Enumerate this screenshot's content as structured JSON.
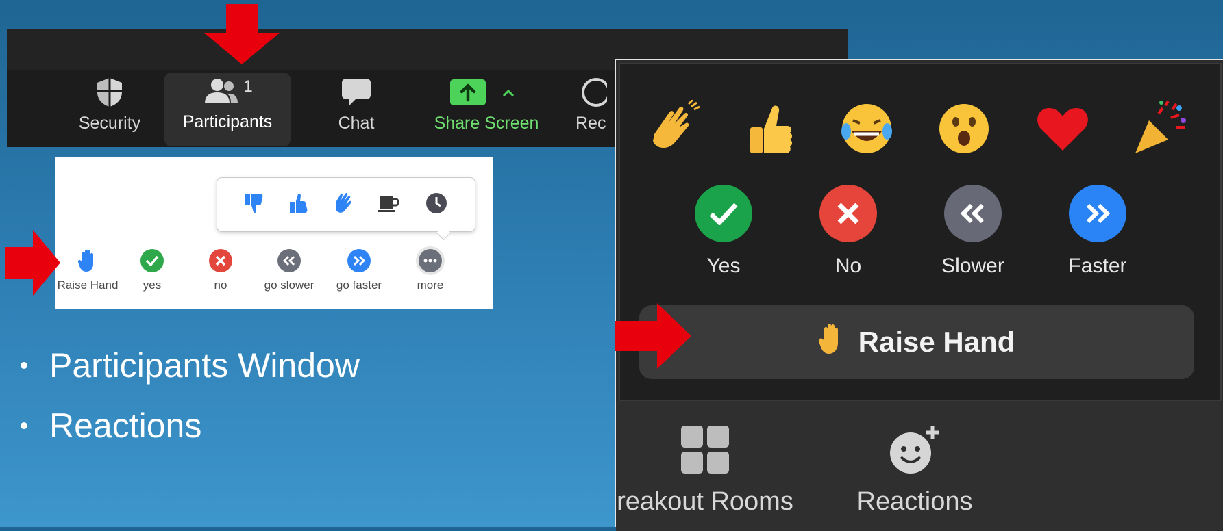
{
  "toolbar": {
    "items": [
      {
        "label": "Security",
        "icon": "shield-icon"
      },
      {
        "label": "Participants",
        "icon": "participants-icon",
        "count": "1"
      },
      {
        "label": "Chat",
        "icon": "chat-bubble-icon"
      },
      {
        "label": "Share Screen",
        "icon": "share-screen-icon"
      },
      {
        "label": "Rec",
        "icon": "record-icon"
      }
    ]
  },
  "reactions_panel": {
    "popover_icons": [
      "thumbs-down-icon",
      "thumbs-up-icon",
      "clap-icon",
      "coffee-icon",
      "clock-icon"
    ],
    "items": [
      {
        "label": "Raise Hand",
        "icon": "raise-hand-icon"
      },
      {
        "label": "yes",
        "icon": "check-icon",
        "color": "#2ea84a"
      },
      {
        "label": "no",
        "icon": "x-icon",
        "color": "#e2463c"
      },
      {
        "label": "go slower",
        "icon": "rewind-icon",
        "color": "#6b6f7a"
      },
      {
        "label": "go faster",
        "icon": "fast-forward-icon",
        "color": "#2f84f5"
      },
      {
        "label": "more",
        "icon": "more-icon",
        "color": "#6b6f7a"
      }
    ]
  },
  "bullets": [
    "Participants Window",
    "Reactions"
  ],
  "dark_reactions": {
    "emojis": [
      "clapping-hands",
      "thumbs-up",
      "tears-of-joy",
      "surprised-face",
      "red-heart",
      "party-popper"
    ],
    "feedback": [
      {
        "label": "Yes",
        "icon": "check-icon",
        "color": "#1aa34a"
      },
      {
        "label": "No",
        "icon": "x-icon",
        "color": "#e5453b"
      },
      {
        "label": "Slower",
        "icon": "rewind-icon",
        "color": "#676a76"
      },
      {
        "label": "Faster",
        "icon": "fast-forward-icon",
        "color": "#2a84f5"
      }
    ],
    "raise_hand_label": "Raise Hand",
    "bottom": [
      {
        "label": "reakout Rooms",
        "icon": "breakout-rooms-icon"
      },
      {
        "label": "Reactions",
        "icon": "reactions-icon"
      }
    ]
  },
  "colors": {
    "accent_green": "#6fe06f",
    "arrow_red": "#e8000d"
  }
}
